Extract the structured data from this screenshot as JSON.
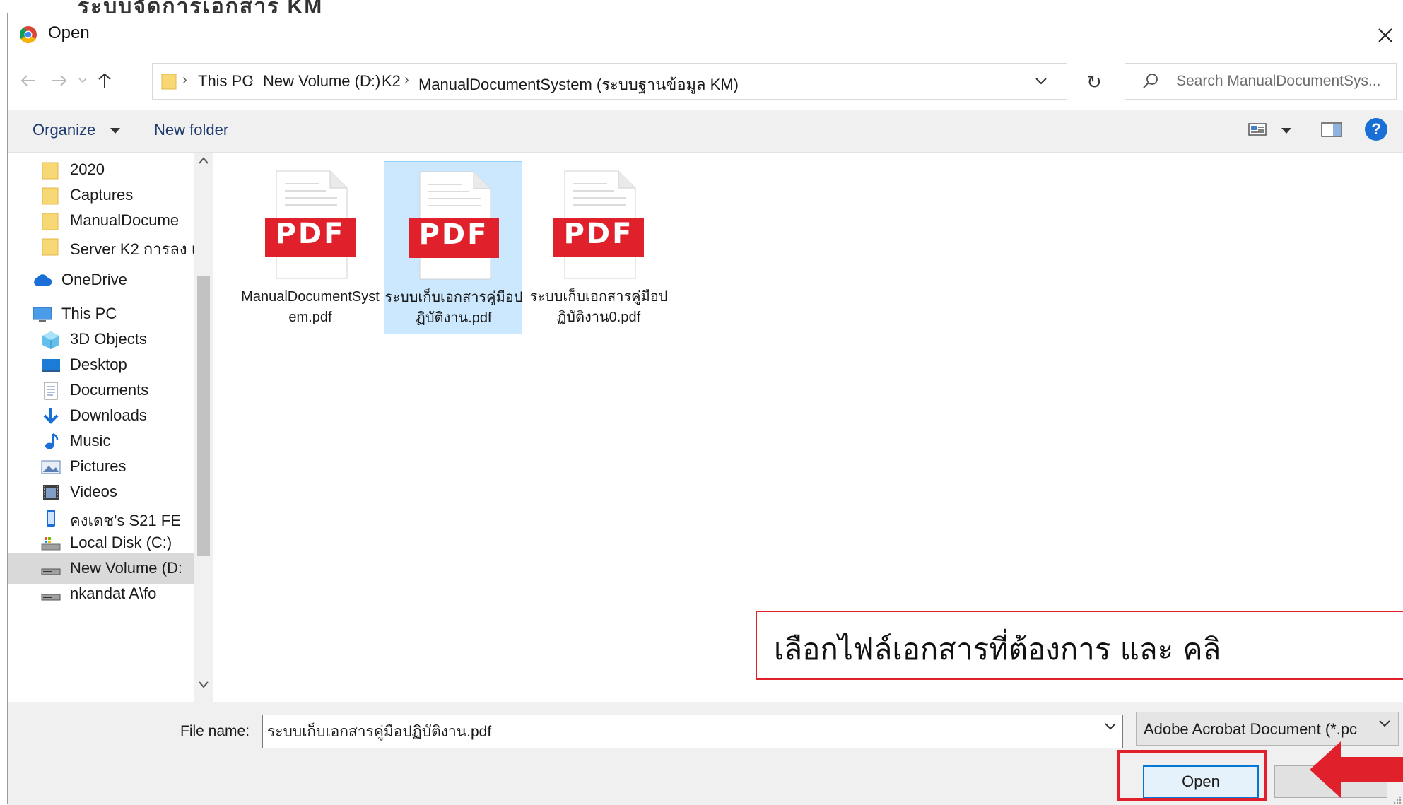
{
  "dialog": {
    "title": "Open",
    "close_glyph": "✕"
  },
  "address": {
    "crumbs": [
      "This PC",
      "New Volume (D:)",
      "K2",
      "ManualDocumentSystem (ระบบฐานข้อมูล KM)"
    ],
    "separator": "›",
    "refresh_glyph": "↻"
  },
  "search": {
    "placeholder": "Search ManualDocumentSys..."
  },
  "toolbar": {
    "organize_label": "Organize",
    "new_folder_label": "New folder",
    "help_label": "?"
  },
  "sidebar": {
    "items": [
      {
        "label": "2020",
        "icon": "folder-icon"
      },
      {
        "label": "Captures",
        "icon": "folder-icon"
      },
      {
        "label": "ManualDocume",
        "icon": "folder-icon"
      },
      {
        "label": "Server K2 การลง แ",
        "icon": "folder-icon"
      },
      {
        "label": "OneDrive",
        "icon": "cloud-icon"
      },
      {
        "label": "This PC",
        "icon": "computer-icon"
      },
      {
        "label": "3D Objects",
        "icon": "cube-icon"
      },
      {
        "label": "Desktop",
        "icon": "desktop-icon"
      },
      {
        "label": "Documents",
        "icon": "documents-icon"
      },
      {
        "label": "Downloads",
        "icon": "download-icon"
      },
      {
        "label": "Music",
        "icon": "music-icon"
      },
      {
        "label": "Pictures",
        "icon": "pictures-icon"
      },
      {
        "label": "Videos",
        "icon": "video-icon"
      },
      {
        "label": "คงเดช's S21 FE",
        "icon": "phone-icon"
      },
      {
        "label": "Local Disk (C:)",
        "icon": "disk-icon"
      },
      {
        "label": "New Volume (D:",
        "icon": "drive-icon",
        "selected": true
      },
      {
        "label": "nkandat A\\fo",
        "icon": "drive-icon"
      }
    ]
  },
  "files": [
    {
      "name": "ManualDocumentSystem.pdf",
      "badge": "PDF",
      "selected": false
    },
    {
      "name": "ระบบเก็บเอกสารคู่มือปฏิบัติงาน.pdf",
      "badge": "PDF",
      "selected": true
    },
    {
      "name": "ระบบเก็บเอกสารคู่มือปฏิบัติงาน0.pdf",
      "badge": "PDF",
      "selected": false
    }
  ],
  "annotation": {
    "text": "เลือกไฟล์เอกสารที่ต้องการ และ คลิ"
  },
  "bottom": {
    "filename_label": "File name:",
    "filename_value": "ระบบเก็บเอกสารคู่มือปฏิบัติงาน.pdf",
    "filetype_value": "Adobe Acrobat Document (*.pc",
    "open_label": "Open",
    "cancel_label": ""
  },
  "background_fragments": [
    "ระบบจัดการเอกสาร KM"
  ],
  "colors": {
    "accent_blue": "#0078d7",
    "selection_bg": "#cce8ff",
    "highlight_red": "#e0212b",
    "pdf_red": "#e0212b",
    "folder_yellow": "#f8d775"
  }
}
